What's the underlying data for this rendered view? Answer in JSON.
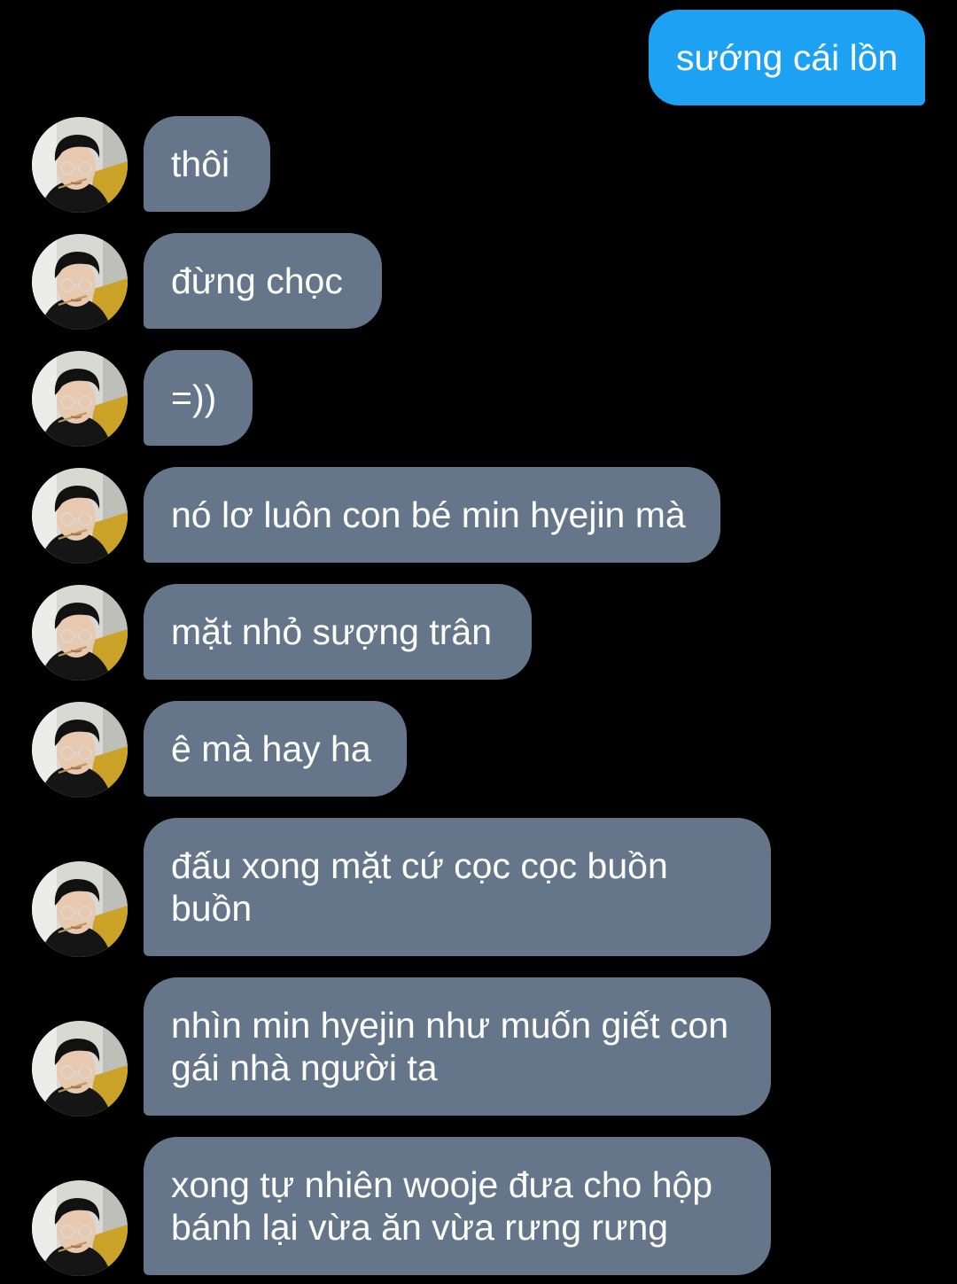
{
  "conversation": {
    "sent": [
      {
        "text": "sướng cái lồn"
      }
    ],
    "received": [
      {
        "text": "thôi"
      },
      {
        "text": "đừng chọc"
      },
      {
        "text": "=))"
      },
      {
        "text": "nó lơ luôn con bé min hyejin mà"
      },
      {
        "text": "mặt nhỏ sượng trân"
      },
      {
        "text": "ê mà hay ha"
      },
      {
        "text": "đấu xong mặt cứ cọc cọc buồn buồn"
      },
      {
        "text": "nhìn min hyejin như muốn giết con gái nhà người ta"
      },
      {
        "text": "xong tự nhiên wooje đưa cho hộp bánh lại vừa ăn vừa rưng rưng"
      }
    ]
  },
  "colors": {
    "background": "#000000",
    "sent_bubble": "#1da1f2",
    "received_bubble": "#66768a",
    "text": "#ffffff"
  },
  "icons": {
    "avatar": "contact-avatar-photo"
  }
}
